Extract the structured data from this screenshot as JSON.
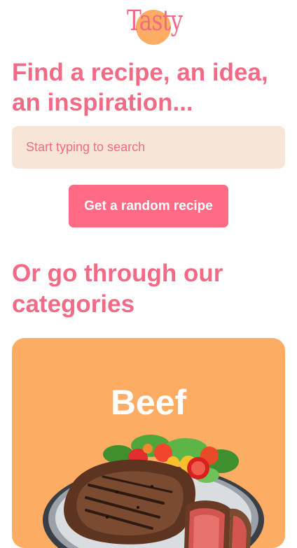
{
  "brand": {
    "logo_text": "Tasty",
    "logo_color": "#f26b86",
    "logo_badge_color": "#fdac63"
  },
  "hero": {
    "headline": "Find a recipe, an idea, an inspiration..."
  },
  "search": {
    "placeholder": "Start typing to search",
    "value": ""
  },
  "random_button": {
    "label": "Get a random recipe"
  },
  "categories_section": {
    "heading": "Or go through our categories",
    "items": [
      {
        "name": "Beef",
        "image_icon": "beef-steak-plate-image",
        "background_color": "#fdac63"
      }
    ]
  },
  "theme": {
    "accent": "#f26b86",
    "button": "#ff6a85",
    "search_background": "#f7e6d8",
    "background": "#ffffff"
  }
}
